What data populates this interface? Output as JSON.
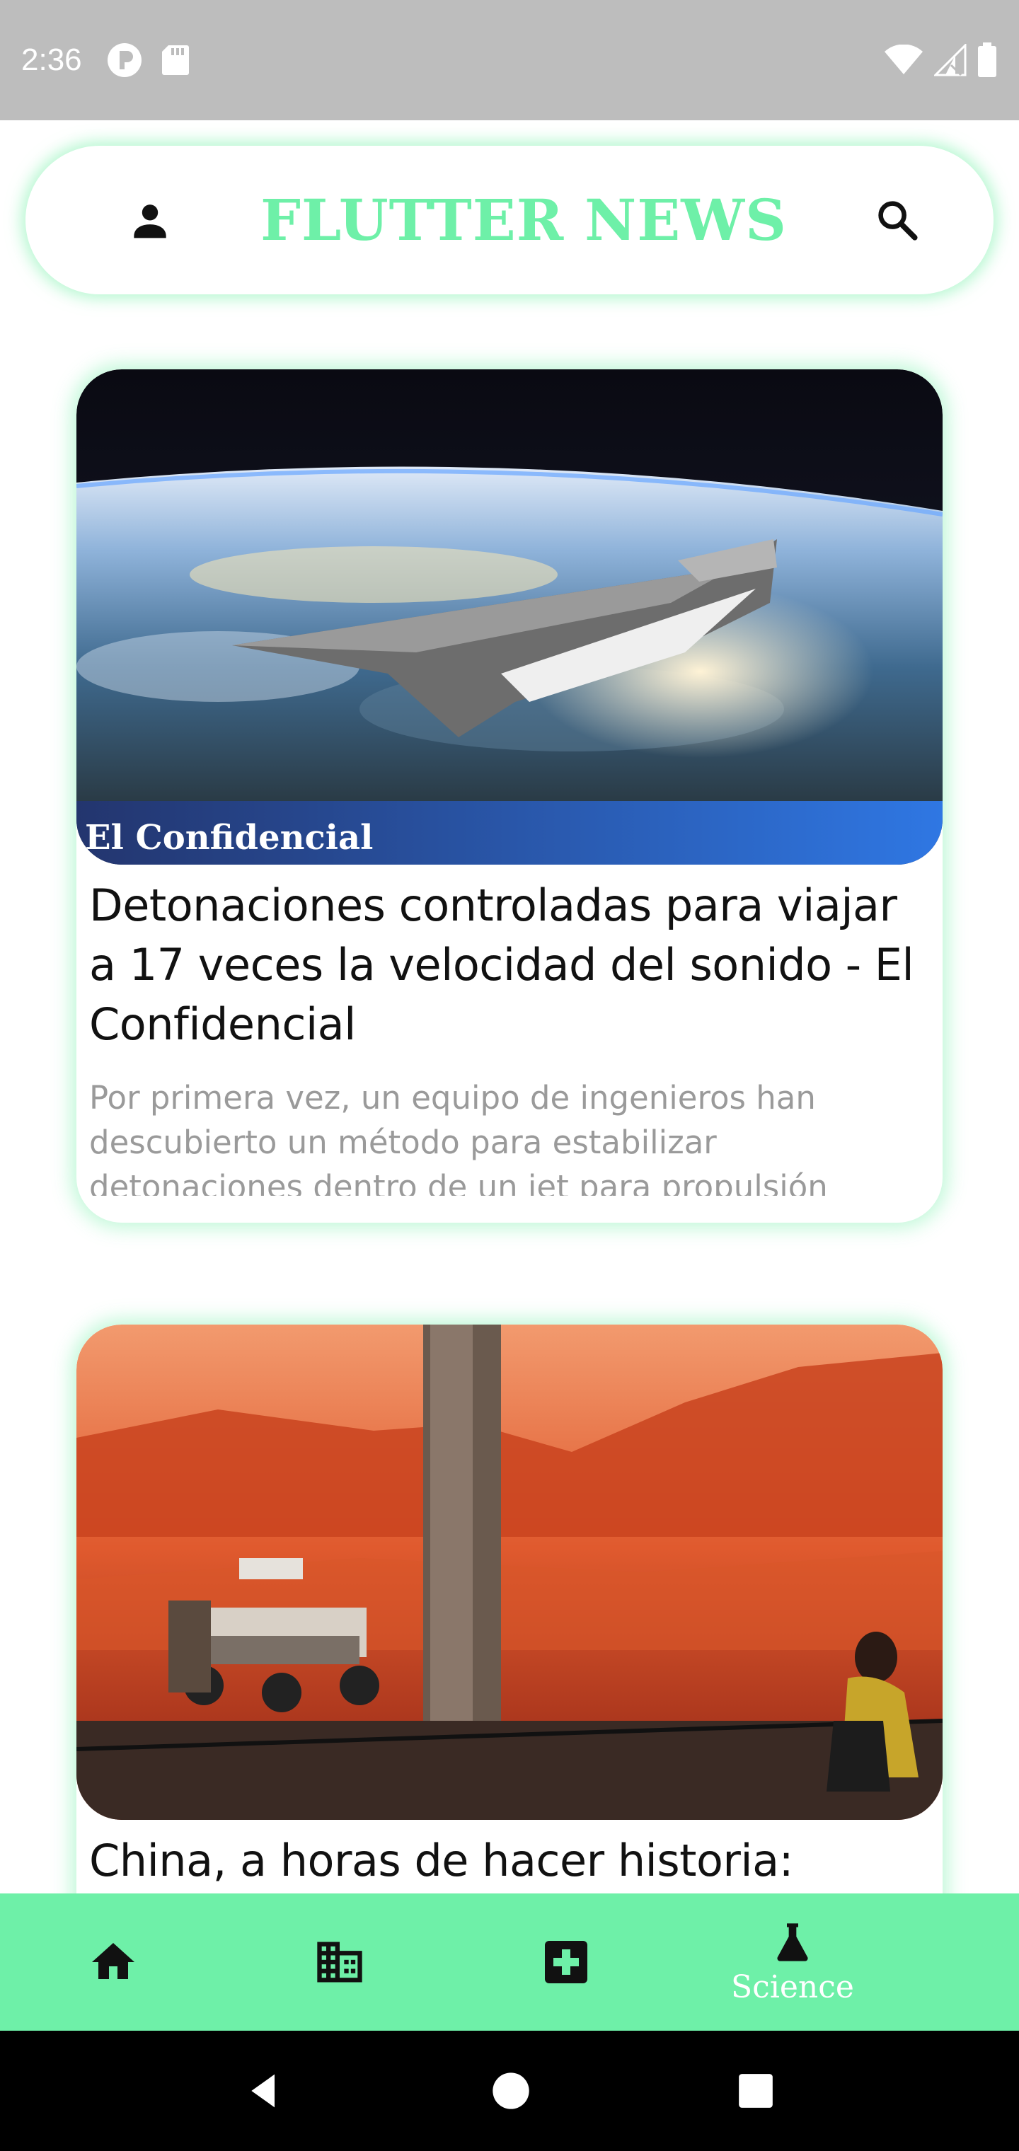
{
  "status_bar": {
    "time": "2:36"
  },
  "app_bar": {
    "title": "FLUTTER NEWS",
    "profile_icon": "person-icon",
    "search_icon": "search-icon"
  },
  "articles": [
    {
      "image_caption": "El Confidencial",
      "title": "Detonaciones controladas para viajar a 17 veces la velocidad del sonido - El Confidencial",
      "description": "Por primera vez, un equipo de ingenieros han descubierto un método para estabilizar detonaciones dentro de un jet para propulsión"
    },
    {
      "title": "China, a horas de hacer historia:"
    }
  ],
  "bottom_nav": {
    "items": [
      {
        "icon": "home-icon"
      },
      {
        "icon": "business-icon"
      },
      {
        "icon": "health-icon"
      },
      {
        "icon": "science-icon",
        "label": "Science",
        "selected": true
      }
    ]
  },
  "colors": {
    "accent": "#6ef0a8",
    "status_bar": "#bdbdbd",
    "desc_text": "#9a9a9a"
  }
}
